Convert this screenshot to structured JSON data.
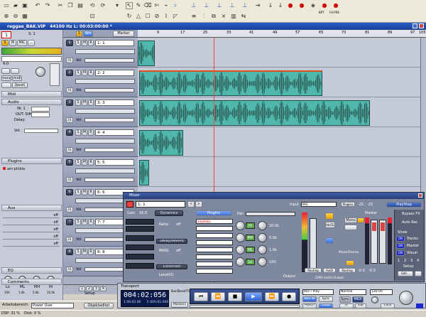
{
  "app": {
    "title": "reggae_BAK.VIP",
    "info": "44100 Hz L: 00:03:00:00 *"
  },
  "toolbar": {
    "icons": [
      "new-file",
      "open-folder",
      "save",
      "cut",
      "copy",
      "paste",
      "undo",
      "redo",
      "preset-dropdown",
      "selector",
      "pencil",
      "eraser",
      "scissors",
      "volume-curve",
      "mute",
      "zoom",
      "fade"
    ],
    "labels": [
      "BPT",
      "FX-PRE"
    ]
  },
  "ruler": {
    "ticks": [
      "9",
      "17",
      "25",
      "33",
      "41",
      "49",
      "57",
      "65",
      "73",
      "81",
      "89",
      "97",
      "105"
    ]
  },
  "inspector": {
    "track_number": "1",
    "s_label": "S: 1",
    "mode_buttons": [
      "S",
      "M",
      "MIC",
      "..."
    ],
    "value": "4.0",
    "small_buttons": [
      "mono",
      "midi",
      "(boot)"
    ],
    "sections": [
      "Midi",
      "Audio",
      "Plugins",
      "Aux",
      "EQ"
    ],
    "audio_fields": [
      "IN: 1",
      "OUT: StMast",
      "Delay:"
    ],
    "vol_label": "Vol:",
    "plugin": "am-phibia",
    "aux_off": "off",
    "eq_labels": [
      "Lo",
      "ML",
      "MH",
      "Hi"
    ],
    "eq_values": [
      "100",
      "1.0k",
      "5.0k",
      "10.0k"
    ],
    "comments": "Comments"
  },
  "tracks": [
    {
      "name": "1: 1",
      "number": "1"
    },
    {
      "name": "2: 2",
      "number": "2"
    },
    {
      "name": "3: 3",
      "number": "3"
    },
    {
      "name": "4: 4",
      "number": "4"
    },
    {
      "name": "5: 5",
      "number": "5"
    },
    {
      "name": "6: 6",
      "number": "6"
    },
    {
      "name": "7: 7",
      "number": "7"
    },
    {
      "name": "8: 8",
      "number": "8"
    }
  ],
  "track_buttons": {
    "s": "S",
    "m": "M",
    "r": "R",
    "vol": "Vol",
    "fx": "FX"
  },
  "head": {
    "s": "S",
    "sm": "Sm",
    "marker": "Marker"
  },
  "bottom": {
    "pages": [
      "1",
      "2",
      "3",
      "4"
    ],
    "setup": "Setup"
  },
  "mixer": {
    "title": "Mixer",
    "track": "1: 1",
    "input_label": "Input",
    "input_value": "MIG",
    "plugins_label": "Plugins",
    "plugin_name": "amphibia",
    "levels": [
      "-25",
      "-25"
    ],
    "playstop": "PlayStop",
    "tabs": [
      "Dynamics",
      "Plugins"
    ],
    "labels": [
      "Gain",
      "Ratio",
      "Delay/Reverb",
      "MKOL",
      "Distortion",
      "Level(0)",
      "Pan"
    ],
    "values": [
      "16.0",
      "off",
      "off"
    ],
    "eq": [
      "Hi",
      "MH",
      "ML",
      "Lo"
    ],
    "eq_values": [
      "10.0k",
      "5.0k",
      "1.0k",
      "100"
    ],
    "routing": [
      "Routing",
      "AutD",
      "Routing"
    ],
    "mute": "MUTE",
    "mono": "Mono",
    "mono_stereo": "Mono/Stereo",
    "out": "Output",
    "outs": "-0.0",
    "master": "Master",
    "side": [
      "Bypass FX",
      "Auto Rec",
      "Show",
      "Tracks",
      "Master",
      "Visual"
    ],
    "side_on": [
      "ON",
      "ON",
      "ON"
    ],
    "pages": [
      "1",
      "2",
      "3",
      "4"
    ],
    "setup": "Setup",
    "edit": "Edit...",
    "bottom": "[DMS Audio]  Output"
  },
  "transport": {
    "title": "Transport",
    "time": "004:02:056",
    "sub1": "1 00:02.00",
    "sub2": "E 005:01:000",
    "label_barsbeat": "Bar/Beat/Tick",
    "markers": "Markers",
    "controls": [
      "rewind",
      "fast-rewind",
      "stop",
      "play",
      "fast-forward",
      "record"
    ],
    "rec_mode": "Rec / Play",
    "rec_m": "REC M",
    "sync": "Sync",
    "punch": "Punch",
    "loop": "Loop",
    "in": "In",
    "out": "Out",
    "normal": "Normal",
    "sync_big": "Sync",
    "midi": "MIDI",
    "speed": "120.00",
    "click": "Click"
  },
  "statusbar": {
    "dsp": "DSP: 31 %",
    "disk": "Disk: 0 %",
    "workspace_label": "Arbeitsbereich:",
    "workspace_value": "Power User",
    "obj_editor": "Objekteditor"
  }
}
